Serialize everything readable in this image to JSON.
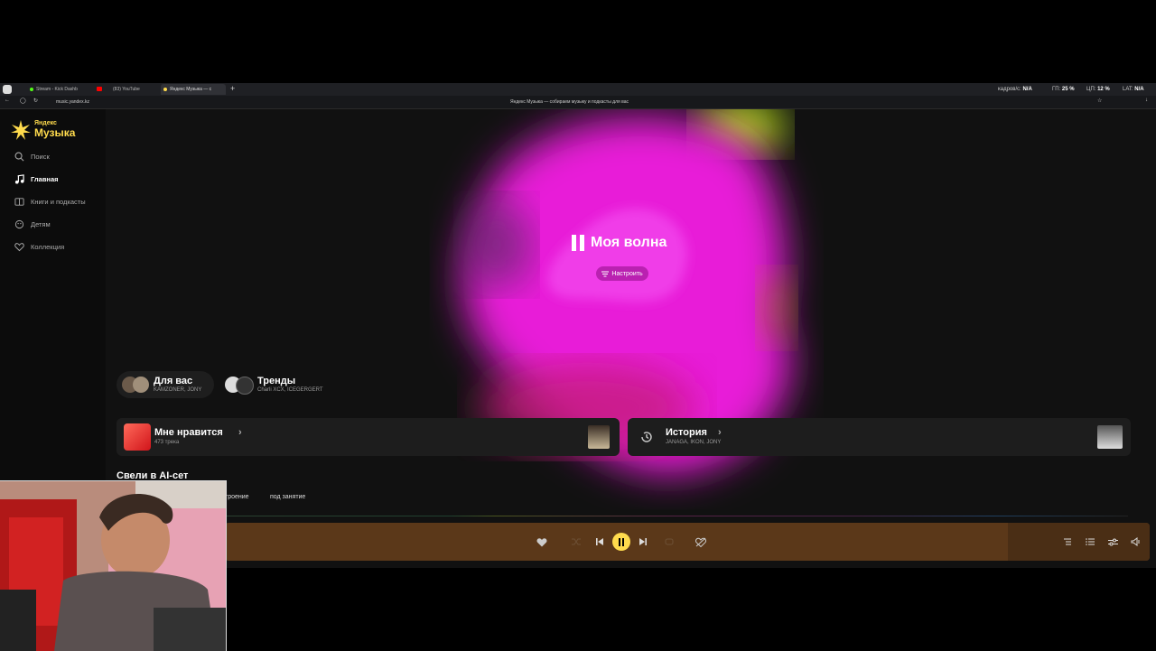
{
  "browser": {
    "tabs": [
      {
        "label": "Stream - Kick Dashb"
      },
      {
        "label": "(83) YouTube"
      },
      {
        "label": "Яндекс Музыка — с"
      }
    ],
    "url": "music.yandex.kz",
    "page_title": "Яндекс Музыка — собираем музыку и подкасты для вас",
    "stats": {
      "fps_label": "кадров/с:",
      "fps_value": "N/A",
      "gpu_label": "ГП:",
      "gpu_value": "25 %",
      "cpu_label": "ЦП:",
      "cpu_value": "12 %",
      "lat_label": "LAT:",
      "lat_value": "N/A"
    }
  },
  "app": {
    "logo_small": "Яндекс",
    "logo_big": "Музыка",
    "nav": [
      {
        "label": "Поиск",
        "icon": "search-icon"
      },
      {
        "label": "Главная",
        "icon": "music-note-icon"
      },
      {
        "label": "Книги и подкасты",
        "icon": "book-icon"
      },
      {
        "label": "Детям",
        "icon": "kids-icon"
      },
      {
        "label": "Коллекция",
        "icon": "heart-icon"
      }
    ],
    "wave": {
      "title": "Моя волна",
      "tune_label": "Настроить"
    },
    "chips": [
      {
        "title": "Для вас",
        "subtitle": "KAMZONER, JONY"
      },
      {
        "title": "Тренды",
        "subtitle": "Charli XCX, ICEGERGERT"
      }
    ],
    "liked": {
      "title": "Мне нравится",
      "subtitle": "473 трека"
    },
    "history": {
      "title": "История",
      "subtitle": "JANAGA, IKON, JONY"
    },
    "section_title": "Свели в AI-сет",
    "filters": [
      "троение",
      "под занятие"
    ],
    "colors": {
      "accent": "#ffdb4d",
      "player_bg": "#5b3819",
      "wave": "#e81ed8"
    }
  }
}
